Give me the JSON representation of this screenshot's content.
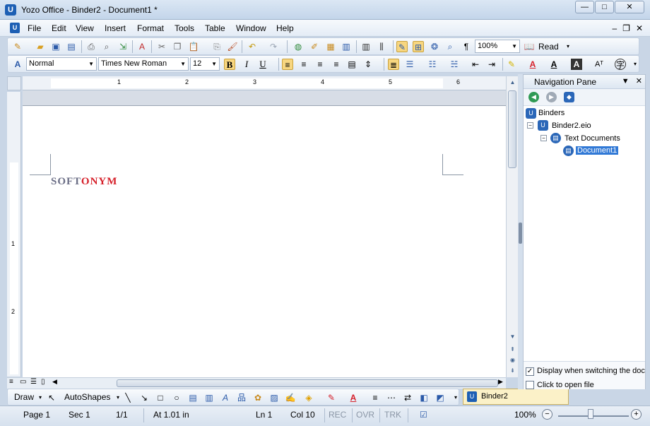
{
  "window": {
    "title": "Yozo Office - Binder2 - Document1 *",
    "app_icon": "yozo-logo-icon",
    "controls": {
      "minimize": "—",
      "maximize": "□",
      "close": "✕"
    }
  },
  "menu": {
    "items": [
      "File",
      "Edit",
      "View",
      "Insert",
      "Format",
      "Tools",
      "Table",
      "Window",
      "Help"
    ],
    "mdi": {
      "minimize": "–",
      "restore": "❐",
      "close": "✕"
    }
  },
  "toolbar": {
    "zoom": "100%",
    "read_label": "Read",
    "style": "Normal",
    "font": "Times New Roman",
    "size": "12",
    "bold": "B",
    "italic": "I",
    "underline": "U",
    "pilcrow": "¶"
  },
  "ruler": {
    "numbers": [
      "1",
      "2",
      "3",
      "4",
      "5",
      "6"
    ],
    "vnumbers": [
      "1",
      "1",
      "2"
    ]
  },
  "document": {
    "text_part1": "SOFT",
    "text_part2": "ONYM",
    "colors": {
      "part1": "#6b6e86",
      "part2": "#d6202a"
    }
  },
  "drawing_toolbar": {
    "draw": "Draw",
    "autoshapes": "AutoShapes"
  },
  "binder_tab": {
    "label": "Binder2"
  },
  "nav_pane": {
    "title": "Navigation Pane",
    "tree": {
      "root": "Binders",
      "binder": "Binder2.eio",
      "folder": "Text Documents",
      "document": "Document1"
    },
    "options": {
      "display_when_switching": "Display when switching the document",
      "display_checked": true,
      "click_to_open": "Click to open file",
      "click_checked": false
    }
  },
  "status": {
    "page": "Page 1",
    "sec": "Sec 1",
    "pages": "1/1",
    "at": "At 1.01 in",
    "ln": "Ln 1",
    "col": "Col 10",
    "rec": "REC",
    "ovr": "OVR",
    "trk": "TRK",
    "zoom": "100%"
  }
}
